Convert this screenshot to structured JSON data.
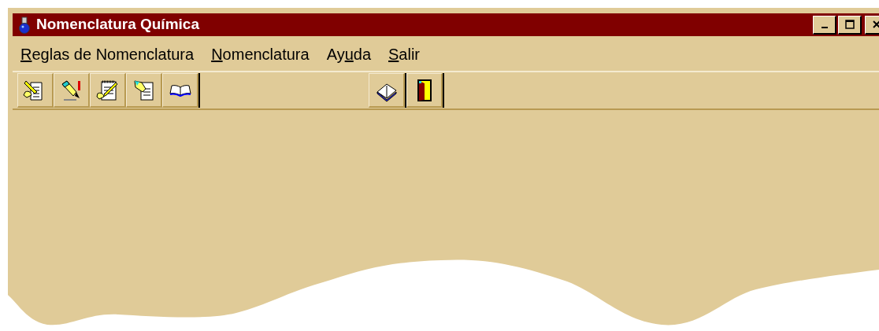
{
  "window": {
    "title": "Nomenclatura Química"
  },
  "title_buttons": [
    {
      "kind": "minimize"
    },
    {
      "kind": "maximize"
    },
    {
      "kind": "close"
    }
  ],
  "menu": [
    {
      "key": "R",
      "after": "eglas de Nomenclatura"
    },
    {
      "key": "N",
      "after": "omenclatura"
    },
    {
      "before": "Ay",
      "key": "u",
      "after": "da"
    },
    {
      "key": "S",
      "after": "alir"
    }
  ],
  "toolbar_left": [
    {
      "kind": "document-pencil"
    },
    {
      "kind": "pen-hand"
    },
    {
      "kind": "notepad-pencil"
    },
    {
      "kind": "document-hand"
    },
    {
      "kind": "open-book"
    }
  ],
  "toolbar_right": [
    {
      "kind": "book"
    },
    {
      "kind": "door"
    }
  ]
}
